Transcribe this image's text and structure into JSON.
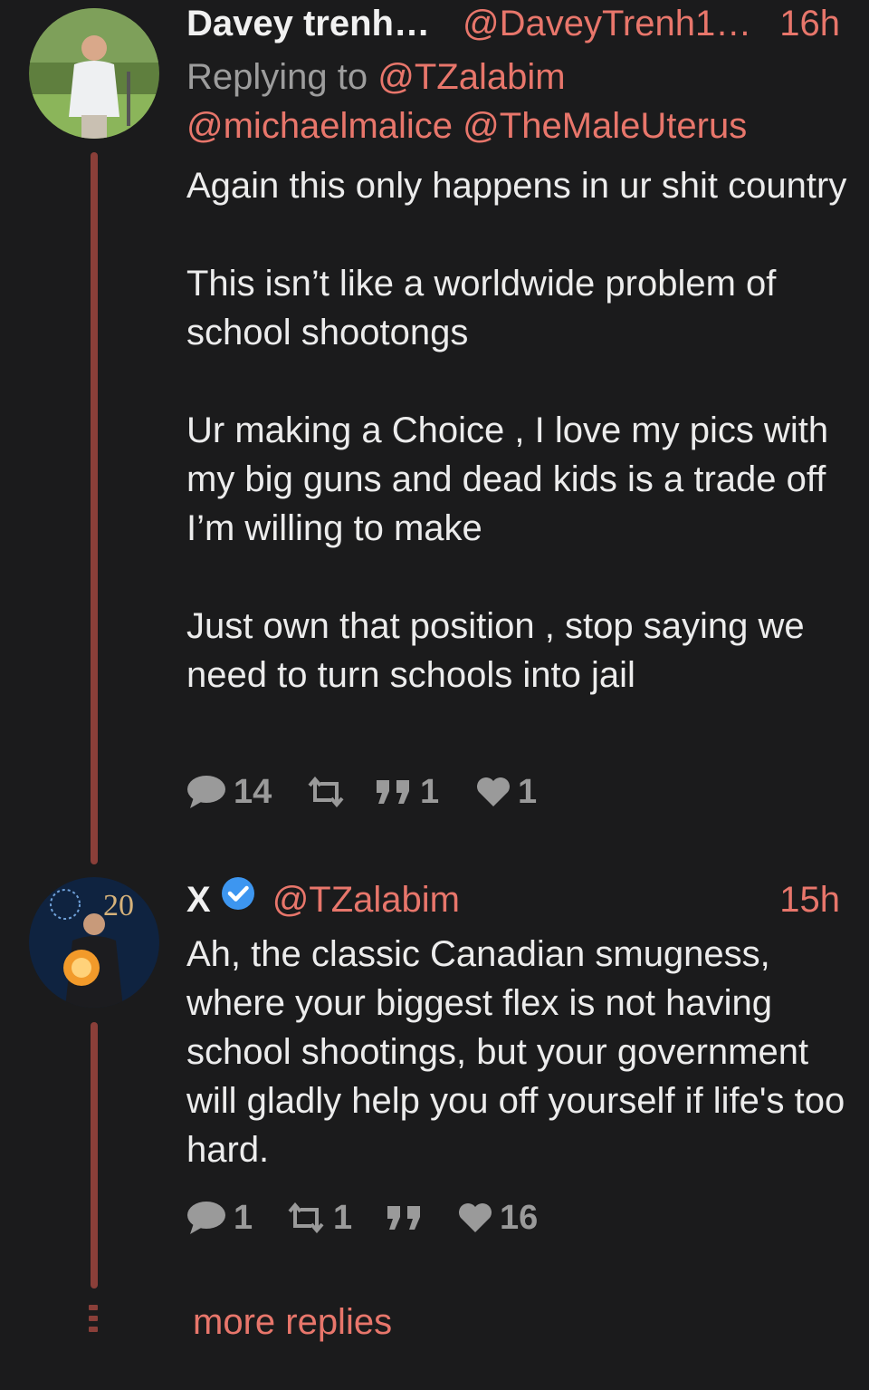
{
  "tweets": [
    {
      "name": "Davey trenh…",
      "handle": "@DaveyTrenh1…",
      "time": "16h",
      "replying_prefix": "Replying to",
      "replying_1": "@TZalabim",
      "replying_2": "@michaelmalice",
      "replying_3": "@TheMaleUterus",
      "paragraphs": [
        "Again this only happens in ur shit country",
        "This isn’t like a worldwide problem of school shootongs",
        "Ur making a Choice , I love my pics with my big guns and dead kids is a trade off I’m willing to make",
        "Just own that position , stop saying we need to turn schools into jail"
      ],
      "replies": "14",
      "retweets": "",
      "quotes": "1",
      "likes": "1"
    },
    {
      "name": "X",
      "handle": "@TZalabim",
      "time": "15h",
      "text": "Ah, the classic Canadian smugness, where your biggest flex is not having school shootings, but your government will gladly help you off yourself if life's too hard.",
      "replies": "1",
      "retweets": "1",
      "quotes": "",
      "likes": "16"
    }
  ],
  "more_replies": "more replies",
  "colors": {
    "background": "#1b1b1c",
    "accent": "#e8766b",
    "thread_line": "#8a3f39",
    "icon": "#9a9a9a",
    "verified": "#3d96f0"
  }
}
